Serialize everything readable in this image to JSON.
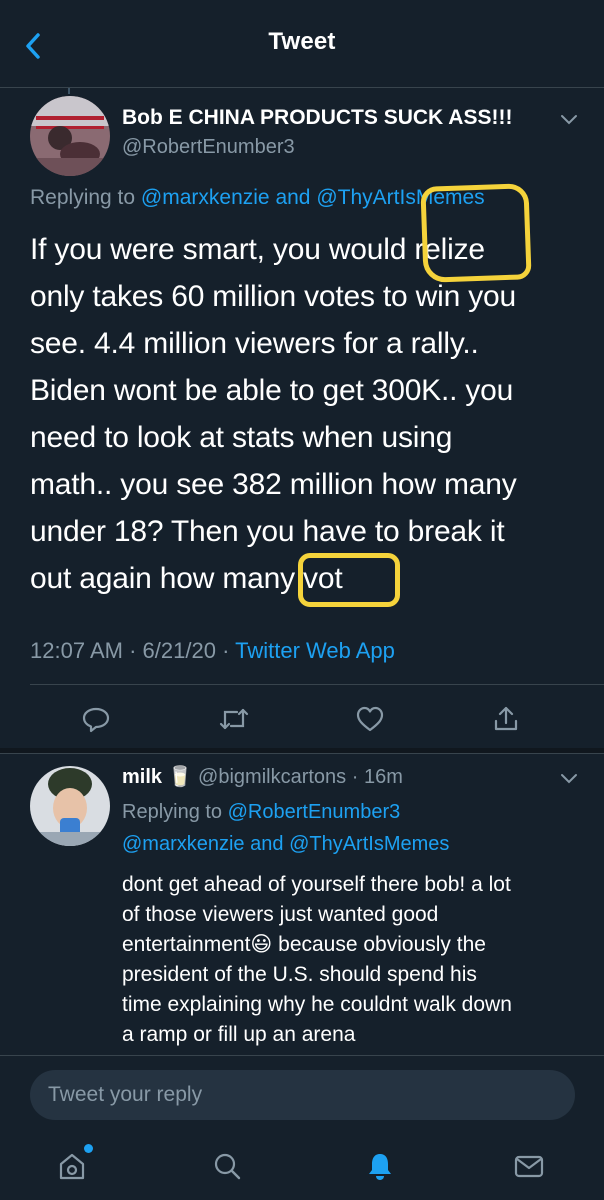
{
  "header": {
    "title": "Tweet"
  },
  "tweet": {
    "author_name": "Bob E CHINA PRODUCTS SUCK ASS!!!",
    "author_handle": "@RobertEnumber3",
    "replying_prefix": "Replying to",
    "replying_to_1": "@marxkenzie",
    "replying_and": "and",
    "replying_to_2": "@ThyArtIsMemes",
    "text": "If you were smart, you would relize\nonly takes 60 million votes to win you\nsee.  4.4 million viewers for a rally..\nBiden wont be able to get 300K.. you\nneed to look at stats when using\nmath.. you see 382 million how many\nunder 18?  Then you have to break it\nout again how many vot",
    "time": "12:07 AM",
    "date": "6/21/20",
    "source": "Twitter Web App"
  },
  "actions": [
    "reply-icon",
    "retweet-icon",
    "like-icon",
    "share-icon"
  ],
  "reply": {
    "author_name": "milk 🥛",
    "author_handle": "@bigmilkcartons",
    "time_ago": "16m",
    "replying_prefix": "Replying to",
    "replying_to_1": "@RobertEnumber3",
    "replying_to_2": "@marxkenzie",
    "replying_and": "and",
    "replying_to_3": "@ThyArtIsMemes",
    "text": "dont get ahead of yourself there bob! a lot\nof those viewers just wanted good\nentertainment😃 because obviously the\npresident of the U.S. should spend his\ntime explaining why he couldnt walk down\na ramp or fill up an arena"
  },
  "composer": {
    "placeholder": "Tweet your reply"
  },
  "tabbar": [
    "home-icon",
    "search-icon",
    "notifications-icon",
    "messages-icon"
  ],
  "colors": {
    "background": "#15202b",
    "accent": "#1da1f2",
    "muted": "#8899a6",
    "highlight": "#f5d33b"
  }
}
